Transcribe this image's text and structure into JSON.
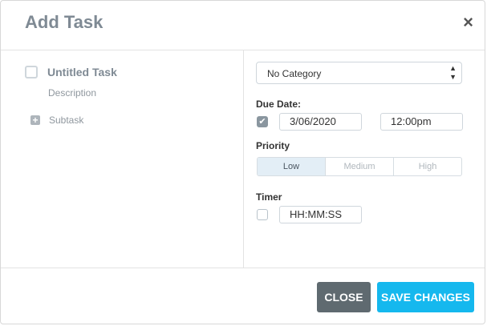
{
  "dialog": {
    "title": "Add Task",
    "close_glyph": "×"
  },
  "task": {
    "title": "Untitled Task",
    "description": "Description",
    "subtask_label": "Subtask",
    "subtask_icon": "plus-icon"
  },
  "category": {
    "selected": "No Category"
  },
  "due_date": {
    "label": "Due Date:",
    "enabled": true,
    "date": "3/06/2020",
    "time": "12:00pm"
  },
  "priority": {
    "label": "Priority",
    "options": [
      "Low",
      "Medium",
      "High"
    ],
    "selected": "Low"
  },
  "timer": {
    "label": "Timer",
    "enabled": false,
    "value": "HH:MM:SS"
  },
  "footer": {
    "close_label": "CLOSE",
    "save_label": "SAVE CHANGES"
  },
  "colors": {
    "accent": "#15b8ee",
    "close_button": "#5f6a70",
    "selected_priority_bg": "#e3eef6"
  }
}
